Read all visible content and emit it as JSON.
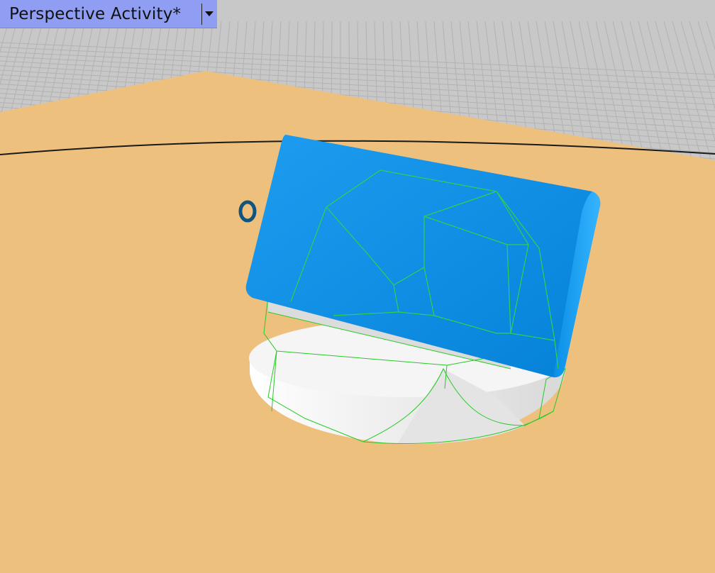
{
  "viewport": {
    "title": "Perspective Activity*",
    "dropdown_icon": "caret-down-icon",
    "colors": {
      "background": "#c8c8c8",
      "grid_lines": "#b4b4b4",
      "build_plate": "#eec07e",
      "part_blue": "#0a8fe6",
      "base_white": "#f2f2f2",
      "wireframe": "#27c927",
      "tab_bg": "#8f9df2",
      "marker": "#11557e"
    }
  }
}
